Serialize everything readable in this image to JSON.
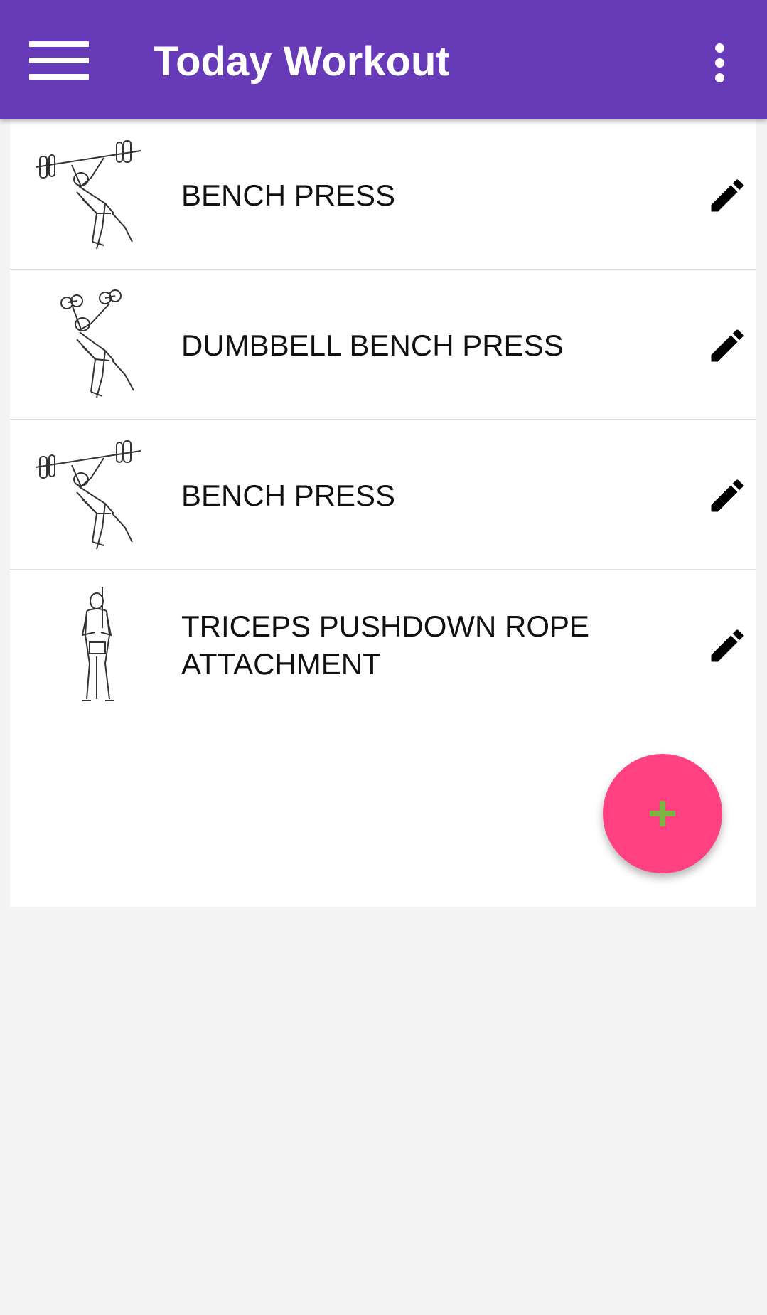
{
  "app_bar": {
    "title": "Today Workout",
    "menu_icon": "hamburger-menu-icon",
    "overflow_icon": "more-vert-icon",
    "color": "#673ab7"
  },
  "workouts": [
    {
      "name": "BENCH PRESS",
      "thumbnail": "barbell-bench-press-illustration",
      "edit_icon": "pencil-icon"
    },
    {
      "name": "DUMBBELL BENCH PRESS",
      "thumbnail": "dumbbell-bench-press-illustration",
      "edit_icon": "pencil-icon"
    },
    {
      "name": "BENCH PRESS",
      "thumbnail": "barbell-bench-press-illustration",
      "edit_icon": "pencil-icon"
    },
    {
      "name": "TRICEPS PUSHDOWN ROPE ATTACHMENT",
      "thumbnail": "triceps-pushdown-illustration",
      "edit_icon": "pencil-icon"
    }
  ],
  "fab": {
    "icon": "plus-icon",
    "color": "#ff4081",
    "icon_color": "#7cb342"
  },
  "colors": {
    "page_background": "#f4f4f4",
    "card_background": "#ffffff"
  }
}
